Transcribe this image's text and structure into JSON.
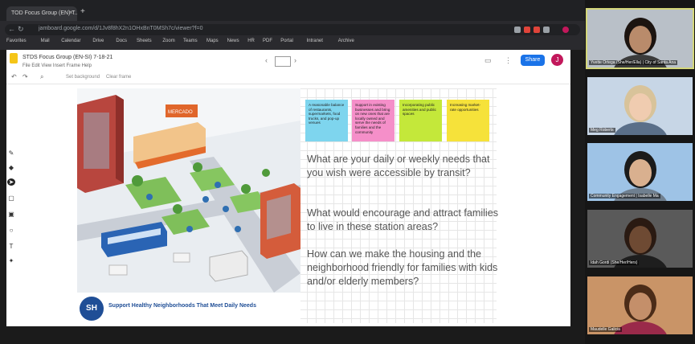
{
  "browser": {
    "tab_title": "TOD Focus Group (EN) T..",
    "tab_close": "×",
    "new_tab": "+",
    "url": "jamboard.google.com/d/1Jv8f8hX2n1OHxBnT0MSh7c/viewer?f=0",
    "bookmarks": [
      "Favorites",
      "Mail",
      "Calendar",
      "Drive",
      "Docs",
      "Sheets",
      "Zoom",
      "Teams",
      "Maps",
      "News",
      "HR",
      "PDF",
      "Portal",
      "Intranet",
      "Archive"
    ]
  },
  "app": {
    "doc_title": "STDS Focus Group (EN-SI) 7-18-21",
    "menu": "File   Edit   View   Insert   Frame   Help",
    "tb_text_1": "Set background",
    "tb_text_2": "Clear frame",
    "share_label": "Share",
    "avatar_letter": "J"
  },
  "slide": {
    "footer_text": "Support Healthy Neighborhoods That Meet Daily Needs",
    "badge_text": "SH",
    "store_sign": "MERCADO",
    "stickies": [
      {
        "text": "A reasonable balance of restaurants, supermarkets, food trucks, and pop-up venues",
        "color": "#7ed5ee"
      },
      {
        "text": "Support in existing businesses and bring on new ones that are locally owned and serve the needs of families and the community",
        "color": "#f58fc9"
      },
      {
        "text": "Incorporating public amenities and public spaces",
        "color": "#c4e83a"
      },
      {
        "text": "Increasing market-rate opportunities",
        "color": "#f6e23a"
      }
    ],
    "questions": [
      "What are your daily or weekly needs that you wish were accessible by transit?",
      "What would encourage and attract families to live in these station areas?",
      "How can we make the housing and the neighborhood friendly for families with kids and/or elderly members?"
    ]
  },
  "participants": [
    {
      "name": "Yvette Ortega (She/Her/Ella) | City of Santa Ana",
      "bg": "#b9c0c8",
      "skin": "#b98b6b",
      "hair": "#1c1410",
      "shirt": "#3b3b3b"
    },
    {
      "name": "Meg Roberts",
      "bg": "#c7d6e6",
      "skin": "#f0ccb0",
      "hair": "#d8c39a",
      "shirt": "#5a6f89"
    },
    {
      "name": "Community Engagement | Isabelle Ma",
      "bg": "#9ec3e6",
      "skin": "#d9b08f",
      "hair": "#1b1b1b",
      "shirt": "#6f7f8f"
    },
    {
      "name": "Idah Gordi (She/Her/Hers)",
      "bg": "#5a5a5a",
      "skin": "#6e4a33",
      "hair": "#2a1a12",
      "shirt": "#1e1e1e"
    },
    {
      "name": "Maudelle Galicia",
      "bg": "#c99467",
      "skin": "#c48f6a",
      "hair": "#4b2c18",
      "shirt": "#9a2a4a"
    }
  ],
  "colors": {
    "share_blue": "#1a73e8",
    "badge_blue": "#1f4e96",
    "question_gray": "#555555"
  }
}
